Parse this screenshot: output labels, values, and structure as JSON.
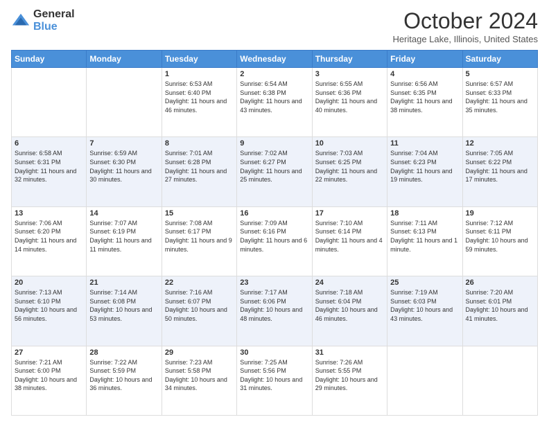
{
  "header": {
    "logo_general": "General",
    "logo_blue": "Blue",
    "title": "October 2024",
    "location": "Heritage Lake, Illinois, United States"
  },
  "days_of_week": [
    "Sunday",
    "Monday",
    "Tuesday",
    "Wednesday",
    "Thursday",
    "Friday",
    "Saturday"
  ],
  "weeks": [
    [
      {
        "num": "",
        "sunrise": "",
        "sunset": "",
        "daylight": "",
        "empty": true
      },
      {
        "num": "",
        "sunrise": "",
        "sunset": "",
        "daylight": "",
        "empty": true
      },
      {
        "num": "1",
        "sunrise": "Sunrise: 6:53 AM",
        "sunset": "Sunset: 6:40 PM",
        "daylight": "Daylight: 11 hours and 46 minutes."
      },
      {
        "num": "2",
        "sunrise": "Sunrise: 6:54 AM",
        "sunset": "Sunset: 6:38 PM",
        "daylight": "Daylight: 11 hours and 43 minutes."
      },
      {
        "num": "3",
        "sunrise": "Sunrise: 6:55 AM",
        "sunset": "Sunset: 6:36 PM",
        "daylight": "Daylight: 11 hours and 40 minutes."
      },
      {
        "num": "4",
        "sunrise": "Sunrise: 6:56 AM",
        "sunset": "Sunset: 6:35 PM",
        "daylight": "Daylight: 11 hours and 38 minutes."
      },
      {
        "num": "5",
        "sunrise": "Sunrise: 6:57 AM",
        "sunset": "Sunset: 6:33 PM",
        "daylight": "Daylight: 11 hours and 35 minutes."
      }
    ],
    [
      {
        "num": "6",
        "sunrise": "Sunrise: 6:58 AM",
        "sunset": "Sunset: 6:31 PM",
        "daylight": "Daylight: 11 hours and 32 minutes."
      },
      {
        "num": "7",
        "sunrise": "Sunrise: 6:59 AM",
        "sunset": "Sunset: 6:30 PM",
        "daylight": "Daylight: 11 hours and 30 minutes."
      },
      {
        "num": "8",
        "sunrise": "Sunrise: 7:01 AM",
        "sunset": "Sunset: 6:28 PM",
        "daylight": "Daylight: 11 hours and 27 minutes."
      },
      {
        "num": "9",
        "sunrise": "Sunrise: 7:02 AM",
        "sunset": "Sunset: 6:27 PM",
        "daylight": "Daylight: 11 hours and 25 minutes."
      },
      {
        "num": "10",
        "sunrise": "Sunrise: 7:03 AM",
        "sunset": "Sunset: 6:25 PM",
        "daylight": "Daylight: 11 hours and 22 minutes."
      },
      {
        "num": "11",
        "sunrise": "Sunrise: 7:04 AM",
        "sunset": "Sunset: 6:23 PM",
        "daylight": "Daylight: 11 hours and 19 minutes."
      },
      {
        "num": "12",
        "sunrise": "Sunrise: 7:05 AM",
        "sunset": "Sunset: 6:22 PM",
        "daylight": "Daylight: 11 hours and 17 minutes."
      }
    ],
    [
      {
        "num": "13",
        "sunrise": "Sunrise: 7:06 AM",
        "sunset": "Sunset: 6:20 PM",
        "daylight": "Daylight: 11 hours and 14 minutes."
      },
      {
        "num": "14",
        "sunrise": "Sunrise: 7:07 AM",
        "sunset": "Sunset: 6:19 PM",
        "daylight": "Daylight: 11 hours and 11 minutes."
      },
      {
        "num": "15",
        "sunrise": "Sunrise: 7:08 AM",
        "sunset": "Sunset: 6:17 PM",
        "daylight": "Daylight: 11 hours and 9 minutes."
      },
      {
        "num": "16",
        "sunrise": "Sunrise: 7:09 AM",
        "sunset": "Sunset: 6:16 PM",
        "daylight": "Daylight: 11 hours and 6 minutes."
      },
      {
        "num": "17",
        "sunrise": "Sunrise: 7:10 AM",
        "sunset": "Sunset: 6:14 PM",
        "daylight": "Daylight: 11 hours and 4 minutes."
      },
      {
        "num": "18",
        "sunrise": "Sunrise: 7:11 AM",
        "sunset": "Sunset: 6:13 PM",
        "daylight": "Daylight: 11 hours and 1 minute."
      },
      {
        "num": "19",
        "sunrise": "Sunrise: 7:12 AM",
        "sunset": "Sunset: 6:11 PM",
        "daylight": "Daylight: 10 hours and 59 minutes."
      }
    ],
    [
      {
        "num": "20",
        "sunrise": "Sunrise: 7:13 AM",
        "sunset": "Sunset: 6:10 PM",
        "daylight": "Daylight: 10 hours and 56 minutes."
      },
      {
        "num": "21",
        "sunrise": "Sunrise: 7:14 AM",
        "sunset": "Sunset: 6:08 PM",
        "daylight": "Daylight: 10 hours and 53 minutes."
      },
      {
        "num": "22",
        "sunrise": "Sunrise: 7:16 AM",
        "sunset": "Sunset: 6:07 PM",
        "daylight": "Daylight: 10 hours and 50 minutes."
      },
      {
        "num": "23",
        "sunrise": "Sunrise: 7:17 AM",
        "sunset": "Sunset: 6:06 PM",
        "daylight": "Daylight: 10 hours and 48 minutes."
      },
      {
        "num": "24",
        "sunrise": "Sunrise: 7:18 AM",
        "sunset": "Sunset: 6:04 PM",
        "daylight": "Daylight: 10 hours and 46 minutes."
      },
      {
        "num": "25",
        "sunrise": "Sunrise: 7:19 AM",
        "sunset": "Sunset: 6:03 PM",
        "daylight": "Daylight: 10 hours and 43 minutes."
      },
      {
        "num": "26",
        "sunrise": "Sunrise: 7:20 AM",
        "sunset": "Sunset: 6:01 PM",
        "daylight": "Daylight: 10 hours and 41 minutes."
      }
    ],
    [
      {
        "num": "27",
        "sunrise": "Sunrise: 7:21 AM",
        "sunset": "Sunset: 6:00 PM",
        "daylight": "Daylight: 10 hours and 38 minutes."
      },
      {
        "num": "28",
        "sunrise": "Sunrise: 7:22 AM",
        "sunset": "Sunset: 5:59 PM",
        "daylight": "Daylight: 10 hours and 36 minutes."
      },
      {
        "num": "29",
        "sunrise": "Sunrise: 7:23 AM",
        "sunset": "Sunset: 5:58 PM",
        "daylight": "Daylight: 10 hours and 34 minutes."
      },
      {
        "num": "30",
        "sunrise": "Sunrise: 7:25 AM",
        "sunset": "Sunset: 5:56 PM",
        "daylight": "Daylight: 10 hours and 31 minutes."
      },
      {
        "num": "31",
        "sunrise": "Sunrise: 7:26 AM",
        "sunset": "Sunset: 5:55 PM",
        "daylight": "Daylight: 10 hours and 29 minutes."
      },
      {
        "num": "",
        "sunrise": "",
        "sunset": "",
        "daylight": "",
        "empty": true
      },
      {
        "num": "",
        "sunrise": "",
        "sunset": "",
        "daylight": "",
        "empty": true
      }
    ]
  ]
}
